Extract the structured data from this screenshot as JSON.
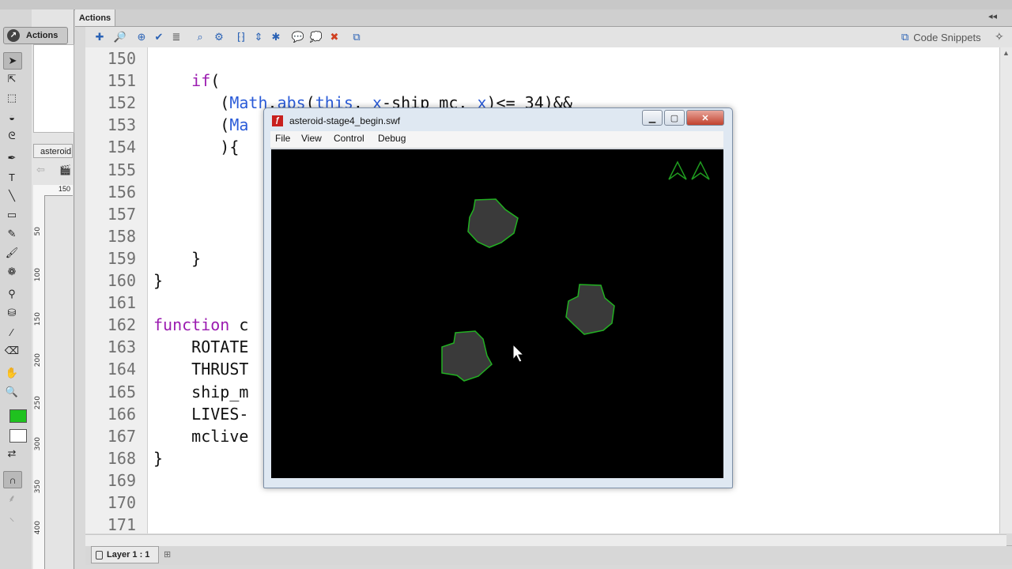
{
  "app": {
    "panel_title": "Actions",
    "code_snippets_label": "Code Snippets",
    "library_tab": "asteroid",
    "ruler_values": [
      "150",
      "50",
      "100",
      "150",
      "200",
      "250",
      "300",
      "350",
      "400"
    ]
  },
  "code": {
    "lines": [
      {
        "num": "150",
        "text": ""
      },
      {
        "num": "151",
        "text": "    if("
      },
      {
        "num": "152",
        "text": "       (Math.abs(this. x-ship_mc. x)<= 34)&&"
      },
      {
        "num": "153",
        "text": "       (Ma"
      },
      {
        "num": "154",
        "text": "       ){"
      },
      {
        "num": "155",
        "text": ""
      },
      {
        "num": "156",
        "text": ""
      },
      {
        "num": "157",
        "text": ""
      },
      {
        "num": "158",
        "text": ""
      },
      {
        "num": "159",
        "text": "    }"
      },
      {
        "num": "160",
        "text": "}"
      },
      {
        "num": "161",
        "text": ""
      },
      {
        "num": "162",
        "text": "function c"
      },
      {
        "num": "163",
        "text": "    ROTATE"
      },
      {
        "num": "164",
        "text": "    THRUST"
      },
      {
        "num": "165",
        "text": "    ship_m"
      },
      {
        "num": "166",
        "text": "    LIVES-"
      },
      {
        "num": "167",
        "text": "    mclive"
      },
      {
        "num": "168",
        "text": "}"
      },
      {
        "num": "169",
        "text": ""
      },
      {
        "num": "170",
        "text": ""
      },
      {
        "num": "171",
        "text": ""
      }
    ]
  },
  "swf_window": {
    "title": "asteroid-stage4_begin.swf",
    "menus": [
      "File",
      "View",
      "Control",
      "Debug"
    ],
    "lives_shown": 2
  },
  "status": {
    "layer_label": "Layer 1 : 1"
  },
  "colors": {
    "accent": "#2a5bd8",
    "keyword_purple": "#9b1bb0",
    "asteroid_fill": "#3a3a3a",
    "asteroid_stroke": "#22b022",
    "stage_bg": "#000000"
  }
}
